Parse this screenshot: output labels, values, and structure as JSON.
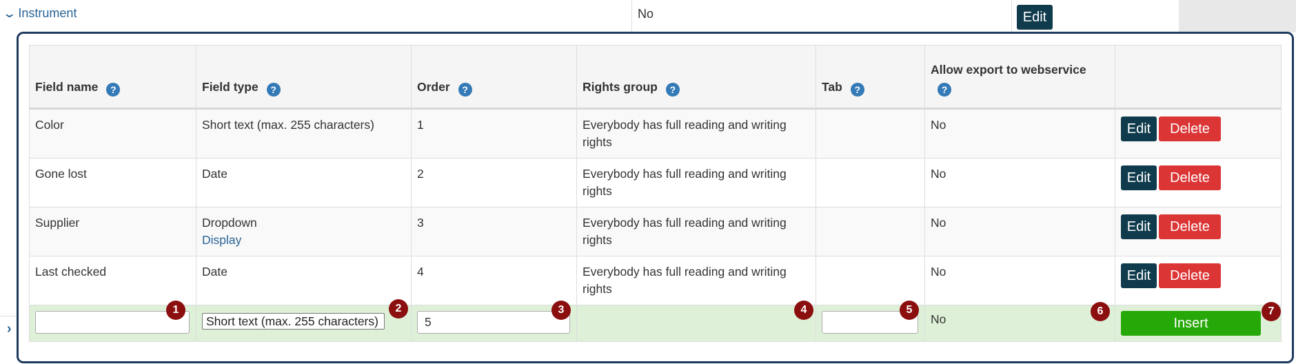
{
  "parent_row": {
    "label": "Instrument",
    "value": "No",
    "edit_label": "Edit"
  },
  "table": {
    "headers": {
      "field_name": "Field name",
      "field_type": "Field type",
      "order": "Order",
      "rights_group": "Rights group",
      "tab": "Tab",
      "allow_export": "Allow export to webservice"
    },
    "rows": [
      {
        "field_name": "Color",
        "field_type": "Short text (max. 255 characters)",
        "type_link": "",
        "order": "1",
        "rights_group": "Everybody has full reading and writing rights",
        "tab": "",
        "allow_export": "No"
      },
      {
        "field_name": "Gone lost",
        "field_type": "Date",
        "type_link": "",
        "order": "2",
        "rights_group": "Everybody has full reading and writing rights",
        "tab": "",
        "allow_export": "No"
      },
      {
        "field_name": "Supplier",
        "field_type": "Dropdown",
        "type_link": "Display",
        "order": "3",
        "rights_group": "Everybody has full reading and writing rights",
        "tab": "",
        "allow_export": "No"
      },
      {
        "field_name": "Last checked",
        "field_type": "Date",
        "type_link": "",
        "order": "4",
        "rights_group": "Everybody has full reading and writing rights",
        "tab": "",
        "allow_export": "No"
      }
    ],
    "edit_label": "Edit",
    "delete_label": "Delete",
    "insert_row": {
      "field_name_value": "",
      "field_type_selected": "Short text (max. 255 characters)",
      "order_value": "5",
      "tab_value": "",
      "allow_export": "No",
      "insert_label": "Insert"
    }
  },
  "badges": [
    "1",
    "2",
    "3",
    "4",
    "5",
    "6",
    "7"
  ],
  "help_icon": "question-circle-icon",
  "colors": {
    "dark_button": "#0f3b4c",
    "delete_button": "#dc3535",
    "insert_button": "#27a809",
    "insert_row_bg": "#dff0d8",
    "badge": "#8b0f0f",
    "frame_border": "#1e3a5f"
  }
}
